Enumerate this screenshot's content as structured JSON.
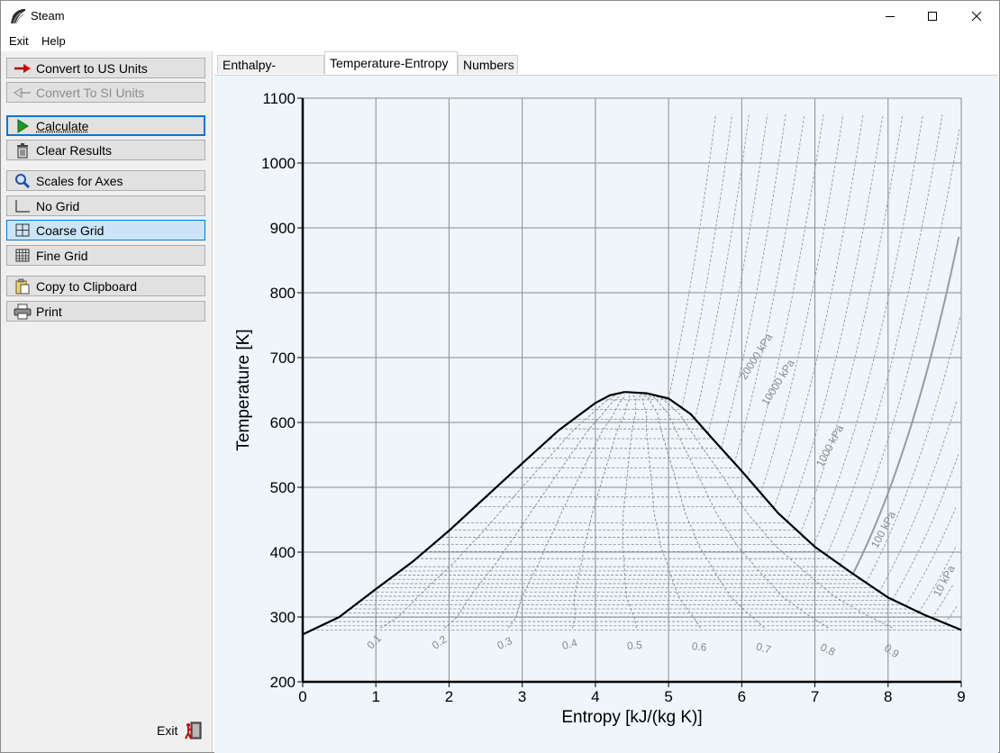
{
  "window": {
    "title": "Steam",
    "controls": {
      "minimize": "minimize-icon",
      "maximize": "maximize-icon",
      "close": "close-icon"
    }
  },
  "menu": {
    "items": [
      "Exit",
      "Help"
    ]
  },
  "sidebar": {
    "buttons": [
      {
        "label": "Convert to US Units",
        "icon": "arrow-right-icon",
        "state": "normal"
      },
      {
        "label": "Convert To SI Units",
        "icon": "arrow-left-icon",
        "state": "disabled"
      },
      {
        "label": "Calculate",
        "icon": "play-icon",
        "state": "focused"
      },
      {
        "label": "Clear Results",
        "icon": "trash-icon",
        "state": "normal"
      },
      {
        "label": "Scales for Axes",
        "icon": "magnifier-icon",
        "state": "normal"
      },
      {
        "label": "No Grid",
        "icon": "axes-icon",
        "state": "normal"
      },
      {
        "label": "Coarse Grid",
        "icon": "coarse-grid-icon",
        "state": "selected"
      },
      {
        "label": "Fine Grid",
        "icon": "fine-grid-icon",
        "state": "normal"
      },
      {
        "label": "Copy to Clipboard",
        "icon": "clipboard-icon",
        "state": "normal"
      },
      {
        "label": "Print",
        "icon": "printer-icon",
        "state": "normal"
      }
    ],
    "exit_label": "Exit"
  },
  "tabs": [
    {
      "label": "Enthalpy-Entropy",
      "active": false
    },
    {
      "label": "Temperature-Entropy",
      "active": true
    },
    {
      "label": "Numbers",
      "active": false
    }
  ],
  "colors": {
    "plot_background": "#eef5fb",
    "grid": "#8c8c8c",
    "saturation_curve": "#000000",
    "quality_lines": "#8a8a8a",
    "isobars": "#9a9a9a"
  },
  "chart_data": {
    "type": "line",
    "xlabel": "Entropy [kJ/(kg K)]",
    "ylabel": "Temperature [K]",
    "xlim": [
      0,
      9
    ],
    "ylim": [
      200,
      1100
    ],
    "xticks": [
      0,
      1,
      2,
      3,
      4,
      5,
      6,
      7,
      8,
      9
    ],
    "yticks": [
      200,
      300,
      400,
      500,
      600,
      700,
      800,
      900,
      1000,
      1100
    ],
    "grid": "coarse",
    "saturation_dome": {
      "liquid": [
        [
          0,
          273
        ],
        [
          0.5,
          300
        ],
        [
          1,
          343
        ],
        [
          1.5,
          385
        ],
        [
          2,
          433
        ],
        [
          2.5,
          485
        ],
        [
          3,
          537
        ],
        [
          3.5,
          588
        ],
        [
          4,
          630
        ],
        [
          4.2,
          642
        ],
        [
          4.4,
          647
        ]
      ],
      "vapor": [
        [
          4.4,
          647
        ],
        [
          4.7,
          645
        ],
        [
          5,
          637
        ],
        [
          5.3,
          613
        ],
        [
          5.6,
          575
        ],
        [
          6,
          525
        ],
        [
          6.5,
          460
        ],
        [
          7,
          408
        ],
        [
          7.5,
          368
        ],
        [
          8,
          330
        ],
        [
          8.5,
          303
        ],
        [
          9,
          280
        ]
      ]
    },
    "quality_labels": [
      "0.1",
      "0.2",
      "0.3",
      "0.4",
      "0.5",
      "0.6",
      "0.7",
      "0.8",
      "0.9"
    ],
    "isobar_labels": [
      "20000 kPa",
      "10000 kPa",
      "1000 kPa",
      "100 kPa",
      "10 kPa"
    ]
  },
  "icons": {
    "app": "steam-app-icon",
    "exit": "exit-icon"
  }
}
